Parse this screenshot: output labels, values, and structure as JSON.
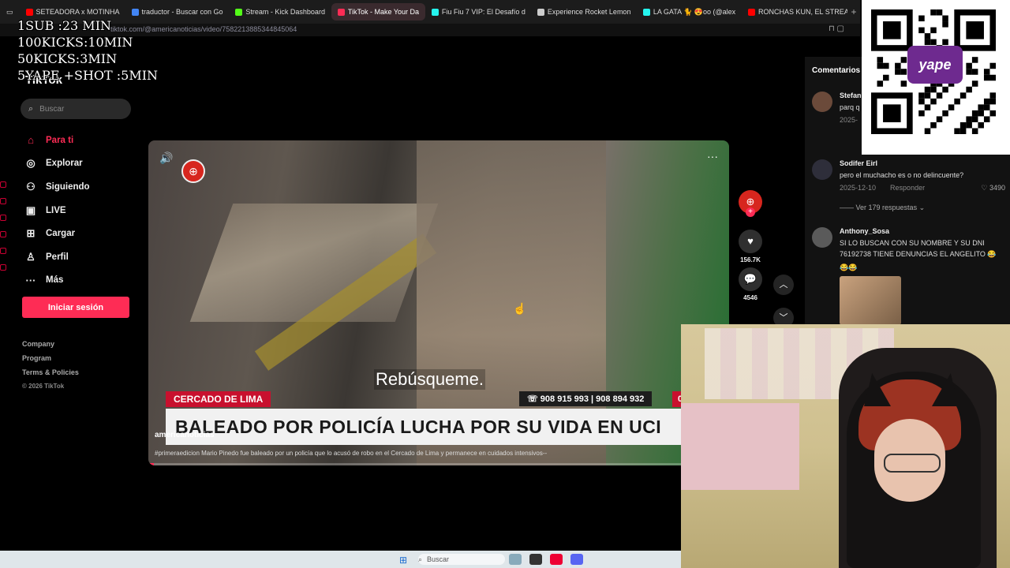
{
  "browser": {
    "tabs": [
      {
        "label": "SETEADORA x MOTINHA",
        "color": "#ff0000"
      },
      {
        "label": "traductor - Buscar con Go",
        "color": "#4285f4"
      },
      {
        "label": "Stream - Kick Dashboard",
        "color": "#53fc18"
      },
      {
        "label": "TikTok - Make Your Da",
        "color": "#fe2c55",
        "active": true
      },
      {
        "label": "Fiu Fiu 7 VIP: El Desafío d",
        "color": "#25f4ee"
      },
      {
        "label": "Experience Rocket Lemon",
        "color": "#cccccc"
      },
      {
        "label": "LA GATA 🐈 😍oo (@alex",
        "color": "#25f4ee"
      },
      {
        "label": "RONCHAS KUN, EL STREA",
        "color": "#ff0000"
      }
    ],
    "add_tab": "+",
    "url": "tiktok.com/@americanoticias/video/7582213885344845064",
    "pin_icons": "⊓ ▢"
  },
  "stream_overlay": {
    "lines": [
      "1SUB :23 MIN",
      "100KICKS:10MIN",
      "50KICKS:3MIN",
      "5YAPE +SHOT :5MIN"
    ]
  },
  "tiktok": {
    "logo": "TikTok",
    "search_placeholder": "Buscar",
    "nav": [
      {
        "label": "Para ti",
        "icon": "home-icon",
        "glyph": "⌂",
        "active": true
      },
      {
        "label": "Explorar",
        "icon": "compass-icon",
        "glyph": "◎"
      },
      {
        "label": "Siguiendo",
        "icon": "following-icon",
        "glyph": "⚇"
      },
      {
        "label": "LIVE",
        "icon": "live-icon",
        "glyph": "▣"
      },
      {
        "label": "Cargar",
        "icon": "upload-icon",
        "glyph": "⊞"
      },
      {
        "label": "Perfil",
        "icon": "profile-icon",
        "glyph": "♙"
      },
      {
        "label": "Más",
        "icon": "more-icon",
        "glyph": "···"
      }
    ],
    "login_button": "Iniciar sesión",
    "footer": [
      "Company",
      "Program",
      "Terms & Policies"
    ],
    "copyright": "© 2026 TikTok"
  },
  "video": {
    "subtitle": "Rebúsqueme.",
    "location_tag": "CERCADO DE LIMA",
    "phones": "☏ 908 915 993  |  908 894 932",
    "red_tab": "0",
    "headline": "BALEADO POR POLICÍA LUCHA POR SU VIDA EN UCI",
    "author": "americanoticias",
    "description": "#primeraedicion Mario Pinedo fue baleado por un policía que lo acusó de robo en el Cercado de Lima y permanece en cuidados intensivos--",
    "progress": 0.01
  },
  "actions": {
    "likes": "156.7K",
    "comments": "4546"
  },
  "comments": {
    "header": "Comentarios",
    "items": [
      {
        "name": "Stefan",
        "text": "parq q",
        "date": "2025-",
        "likes": "",
        "reply": "Responder"
      },
      {
        "name": "Sodifer Eirl",
        "text": "pero el muchacho es o no delincuente?",
        "date": "2025-12-10",
        "reply": "Responder",
        "likes": "3490",
        "replies": "Ver 179 respuestas ⌄"
      },
      {
        "name": "Anthony_Sosa",
        "text": "SI LO BUSCAN CON SU NOMBRE Y SU DNI 76192738 TIENE DENUNCIAS EL ANGELITO 😂",
        "emojis": "😂😂"
      }
    ]
  },
  "qr": {
    "brand": "yape"
  },
  "taskbar": {
    "search": "Buscar"
  },
  "colors": {
    "accent": "#fe2c55",
    "yape": "#6e2a8f"
  }
}
